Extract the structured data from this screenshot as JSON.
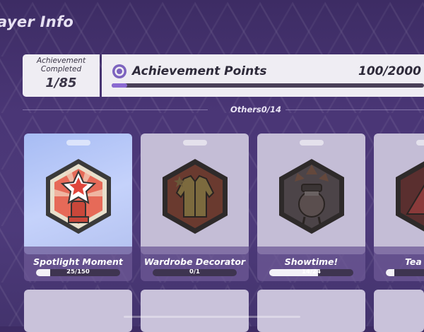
{
  "page": {
    "title": "ayer Info"
  },
  "achievement_completed": {
    "label": "Achievement Completed",
    "value": "1/85"
  },
  "achievement_points": {
    "title": "Achievement Points",
    "score": "100/2000",
    "progress": 0.05
  },
  "section": {
    "label": "Others0/14"
  },
  "cards": [
    {
      "name": "Spotlight Moment",
      "progress_text": "25/150",
      "progress": 0.1667,
      "icon": "star-fist-icon"
    },
    {
      "name": "Wardrobe Decorator",
      "progress_text": "0/1",
      "progress": 0,
      "icon": "jacket-icon"
    },
    {
      "name": "Showtime!",
      "progress_text": "14/24",
      "progress": 0.5833,
      "icon": "performer-icon"
    },
    {
      "name": "Tea",
      "progress_text": "",
      "progress": 0.1,
      "icon": "tent-icon"
    }
  ],
  "colors": {
    "accent": "#8b6ad1",
    "background": "#4a3676",
    "highlight_card": "#b4c2f0"
  }
}
